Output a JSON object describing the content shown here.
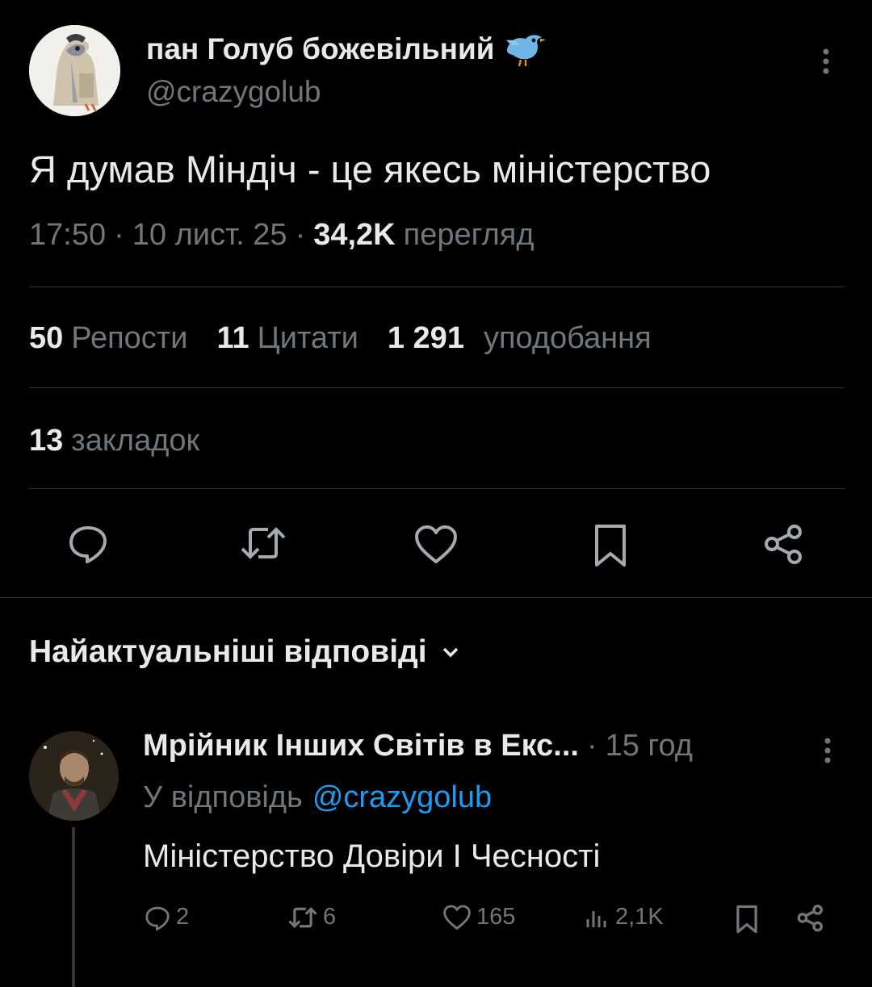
{
  "tweet": {
    "display_name": "пан Голуб божевільний",
    "name_emoji": "🐦",
    "handle": "@crazygolub",
    "text": "Я думав Міндіч - це якесь міністерство",
    "time": "17:50",
    "date": "10 лист. 25",
    "views_count": "34,2K",
    "views_label": "перегляд",
    "sep": "·"
  },
  "stats": {
    "reposts_count": "50",
    "reposts_label": "Репости",
    "quotes_count": "11",
    "quotes_label": "Цитати",
    "likes_count": "1 291",
    "likes_label": "уподобання",
    "bookmarks_count": "13",
    "bookmarks_label": "закладок"
  },
  "replies_header": {
    "label": "Найактуальніші відповіді"
  },
  "reply": {
    "display_name": "Мрійник Інших Світів в Екс...",
    "sep": "·",
    "age": "15 год",
    "reply_prefix": "У відповідь",
    "reply_to": "@crazygolub",
    "text": "Міністерство Довіри І Чесності",
    "replies": "2",
    "reposts": "6",
    "likes": "165",
    "views": "2,1K"
  },
  "colors": {
    "background": "#000000",
    "text": "#e7e9ea",
    "secondary": "#71767b",
    "link": "#1d9bf0",
    "divider": "#2f3336"
  },
  "icons": [
    "more-icon",
    "reply-icon",
    "repost-icon",
    "like-icon",
    "bookmark-icon",
    "share-icon",
    "chevron-down-icon",
    "views-icon",
    "bird-icon"
  ]
}
